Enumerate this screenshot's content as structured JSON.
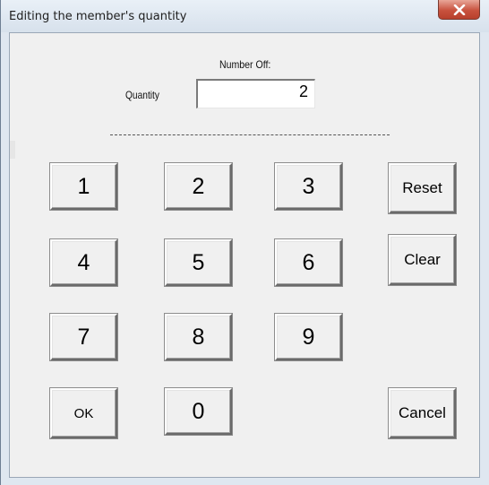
{
  "window": {
    "title": "Editing the member's quantity"
  },
  "form": {
    "number_off_label": "Number Off:",
    "quantity_label": "Quantity",
    "quantity_value": "2"
  },
  "keypad": {
    "k1": "1",
    "k2": "2",
    "k3": "3",
    "k4": "4",
    "k5": "5",
    "k6": "6",
    "k7": "7",
    "k8": "8",
    "k9": "9",
    "k0": "0"
  },
  "actions": {
    "reset": "Reset",
    "clear": "Clear",
    "ok": "OK",
    "cancel": "Cancel"
  }
}
